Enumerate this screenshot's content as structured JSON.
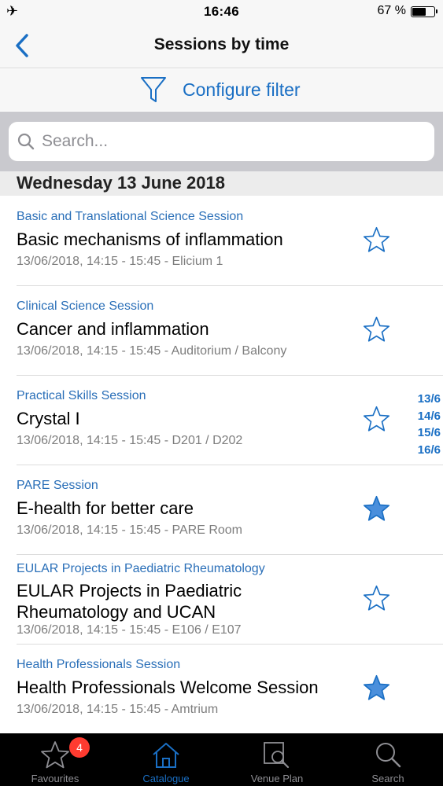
{
  "status_bar": {
    "time": "16:46",
    "battery_percent": "67 %",
    "battery_level": 0.67
  },
  "nav": {
    "title": "Sessions by time",
    "back_icon": "chevron-left-icon"
  },
  "filter": {
    "label": "Configure filter",
    "icon": "funnel-icon"
  },
  "search": {
    "placeholder": "Search...",
    "value": ""
  },
  "section": {
    "header": "Wednesday 13 June 2018"
  },
  "sessions": [
    {
      "category": "Basic and Translational Science Session",
      "title": "Basic mechanisms of inflammation",
      "meta": "13/06/2018, 14:15 - 15:45 - Elicium 1",
      "favourite": false
    },
    {
      "category": "Clinical Science Session",
      "title": "Cancer and inflammation",
      "meta": "13/06/2018, 14:15 - 15:45 - Auditorium / Balcony",
      "favourite": false
    },
    {
      "category": "Practical Skills Session",
      "title": "Crystal I",
      "meta": "13/06/2018, 14:15 - 15:45 - D201 / D202",
      "favourite": false
    },
    {
      "category": "PARE Session",
      "title": "E-health for better care",
      "meta": "13/06/2018, 14:15 - 15:45 - PARE Room",
      "favourite": true
    },
    {
      "category": "EULAR Projects in Paediatric Rheumatology",
      "title": "EULAR Projects in Paediatric Rheumatology and UCAN",
      "meta": "13/06/2018, 14:15 - 15:45 - E106 / E107",
      "favourite": false
    },
    {
      "category": "Health Professionals Session",
      "title": "Health Professionals Welcome Session",
      "meta": "13/06/2018, 14:15 - 15:45 - Amtrium",
      "favourite": true
    }
  ],
  "date_index": [
    "13/6",
    "14/6",
    "15/6",
    "16/6"
  ],
  "tabs": [
    {
      "label": "Favourites",
      "icon": "star-icon",
      "badge": "4",
      "active": false
    },
    {
      "label": "Catalogue",
      "icon": "house-icon",
      "active": true
    },
    {
      "label": "Venue Plan",
      "icon": "map-search-icon",
      "active": false
    },
    {
      "label": "Search",
      "icon": "search-icon",
      "active": false
    }
  ],
  "colors": {
    "accent": "#1a6fc4",
    "category": "#2a6fb8",
    "meta": "#7d7d7d",
    "badge": "#ff3b30",
    "tabbar": "#000000"
  }
}
